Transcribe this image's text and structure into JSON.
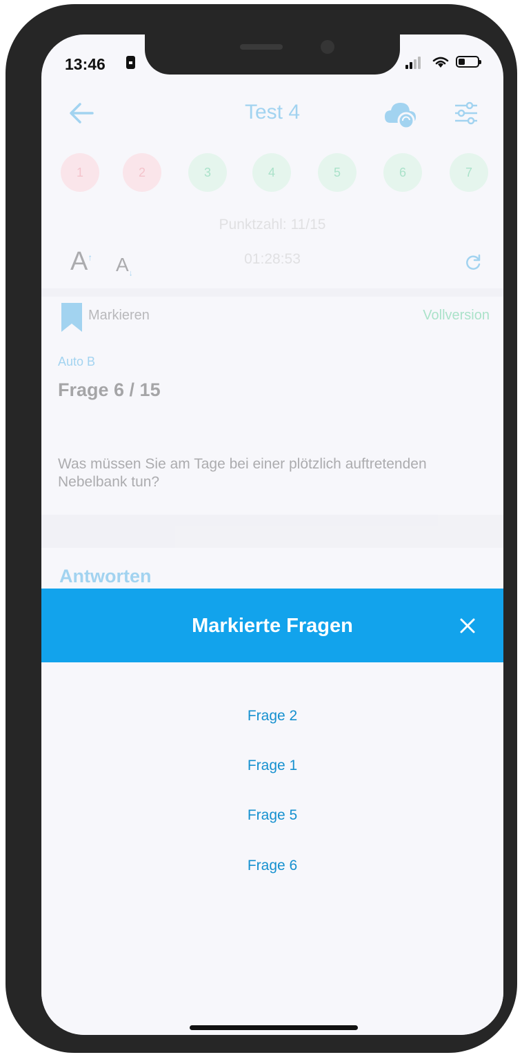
{
  "status_bar": {
    "time": "13:46"
  },
  "header": {
    "title": "Test 4",
    "back_icon": "arrow-left-icon",
    "cloud_icon": "cloud-sync-icon",
    "settings_icon": "sliders-icon"
  },
  "question_nav": [
    {
      "label": "1",
      "state": "wrong"
    },
    {
      "label": "2",
      "state": "wrong"
    },
    {
      "label": "3",
      "state": "correct"
    },
    {
      "label": "4",
      "state": "correct"
    },
    {
      "label": "5",
      "state": "correct"
    },
    {
      "label": "6",
      "state": "correct"
    },
    {
      "label": "7",
      "state": "correct"
    }
  ],
  "score": "Punktzahl: 11/15",
  "controls": {
    "font_increase": "A",
    "font_decrease": "A",
    "timer": "01:28:53"
  },
  "question": {
    "mark_label": "Markieren",
    "full_version": "Vollversion",
    "category": "Auto B",
    "number": "Frage 6 / 15",
    "text": "Was müssen Sie am Tage bei einer plötzlich auftretenden Nebelbank tun?",
    "answers_heading": "Antworten"
  },
  "modal": {
    "title": "Markierte Fragen",
    "items": [
      "Frage 2",
      "Frage 1",
      "Frage 5",
      "Frage 6"
    ]
  },
  "colors": {
    "accent": "#12a3ec",
    "link": "#1590cf",
    "wrong": "#ffc9cf",
    "correct": "#c9f3d9"
  }
}
